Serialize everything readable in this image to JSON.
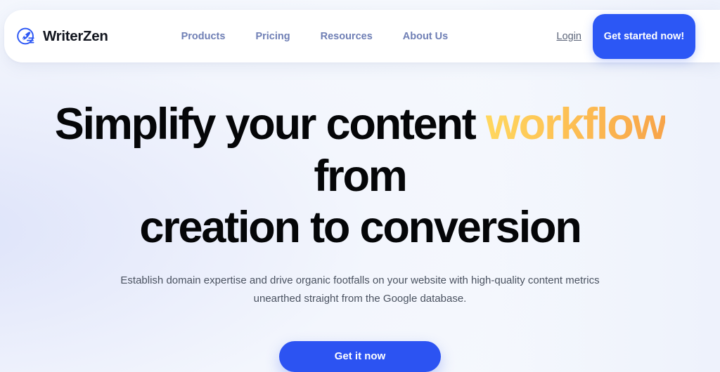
{
  "brand": {
    "name": "WriterZen",
    "logo_icon": "pen-nib-circle-icon",
    "logo_color": "#2c57f5"
  },
  "nav": {
    "links": [
      {
        "label": "Products"
      },
      {
        "label": "Pricing"
      },
      {
        "label": "Resources"
      },
      {
        "label": "About Us"
      }
    ],
    "login_label": "Login",
    "cta_label": "Get started now!",
    "cta_color": "#2c57f5",
    "link_color": "#6f7fb5"
  },
  "hero": {
    "headline_part1": "Simplify your content ",
    "headline_accent": "workflow",
    "headline_part2": " from",
    "headline_line2": "creation to conversion",
    "accent_gradient_from": "#ffd85f",
    "accent_gradient_to": "#f7a349",
    "subtitle_line1": "Establish domain expertise and drive organic footfalls on your website with high-quality content metrics",
    "subtitle_line2": "unearthed straight from the Google database.",
    "cta_label": "Get it now",
    "cta_color": "#2c53f2"
  }
}
